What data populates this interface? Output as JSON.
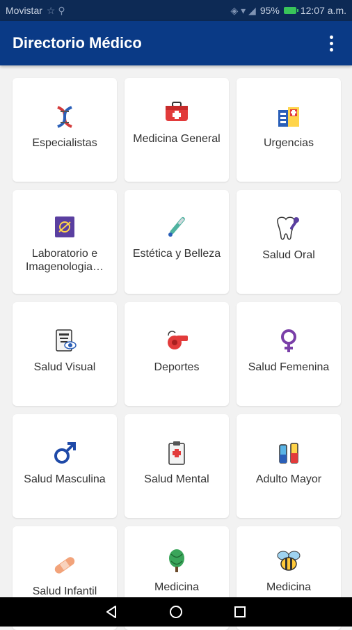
{
  "status": {
    "carrier": "Movistar",
    "battery": "95%",
    "time": "12:07 a.m."
  },
  "appbar": {
    "title": "Directorio Médico"
  },
  "cards": [
    {
      "label": "Especialistas",
      "icon": "dna-icon"
    },
    {
      "label": "Medicina General",
      "icon": "first-aid-kit-icon"
    },
    {
      "label": "Urgencias",
      "icon": "hospital-icon"
    },
    {
      "label": "Laboratorio e Imagenologia…",
      "icon": "lab-imaging-icon"
    },
    {
      "label": "Estética y Belleza",
      "icon": "scalpel-icon"
    },
    {
      "label": "Salud Oral",
      "icon": "tooth-icon"
    },
    {
      "label": "Salud Visual",
      "icon": "eye-chart-icon"
    },
    {
      "label": "Deportes",
      "icon": "whistle-icon"
    },
    {
      "label": "Salud Femenina",
      "icon": "female-symbol-icon"
    },
    {
      "label": "Salud Masculina",
      "icon": "male-symbol-icon"
    },
    {
      "label": "Salud Mental",
      "icon": "clipboard-icon"
    },
    {
      "label": "Adulto Mayor",
      "icon": "test-tubes-icon"
    },
    {
      "label": "Salud Infantil",
      "icon": "bandage-icon"
    },
    {
      "label": "Medicina",
      "icon": "herbal-icon"
    },
    {
      "label": "Medicina",
      "icon": "bee-icon"
    }
  ]
}
